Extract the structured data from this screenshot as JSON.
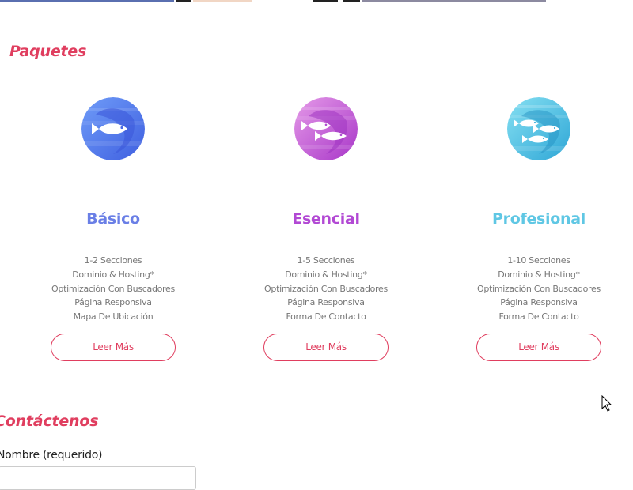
{
  "sections": {
    "packages_title": "Paquetes",
    "contact_title": "Contáctenos"
  },
  "packages": [
    {
      "name": "Básico",
      "icon": "single-fish-icon",
      "color": "#6a7fe6",
      "features": [
        "1-2 Secciones",
        "Dominio & Hosting*",
        "Optimización Con Buscadores",
        "Página Responsiva",
        "Mapa De Ubicación"
      ],
      "button_label": "Leer Más"
    },
    {
      "name": "Esencial",
      "icon": "two-fish-icon",
      "color": "#b249d4",
      "features": [
        "1-5 Secciones",
        "Dominio & Hosting*",
        "Optimización Con Buscadores",
        "Página Responsiva",
        "Forma De Contacto"
      ],
      "button_label": "Leer Más"
    },
    {
      "name": "Profesional",
      "icon": "three-fish-icon",
      "color": "#5fc7e4",
      "features": [
        "1-10 Secciones",
        "Dominio & Hosting*",
        "Optimización Con Buscadores",
        "Página Responsiva",
        "Forma De Contacto"
      ],
      "button_label": "Leer Más"
    }
  ],
  "contact_form": {
    "name_label": "Nombre (requerido)",
    "name_value": ""
  },
  "colors": {
    "accent": "#e03e5f",
    "text_muted": "#777777"
  }
}
